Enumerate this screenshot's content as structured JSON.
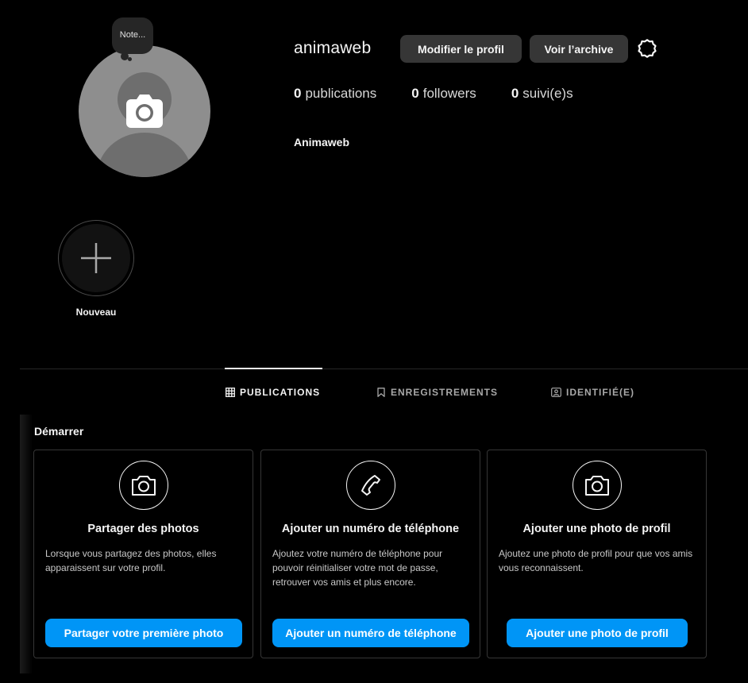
{
  "profile": {
    "note_label": "Note...",
    "username": "animaweb",
    "edit_profile_label": "Modifier le profil",
    "view_archive_label": "Voir l’archive",
    "stats": [
      {
        "count": "0",
        "label": "publications"
      },
      {
        "count": "0",
        "label": "followers"
      },
      {
        "count": "0",
        "label": "suivi(e)s"
      }
    ],
    "full_name": "Animaweb"
  },
  "highlights": {
    "new_label": "Nouveau"
  },
  "tabs": [
    {
      "label": "PUBLICATIONS",
      "icon": "grid-icon",
      "active": true
    },
    {
      "label": "ENREGISTREMENTS",
      "icon": "bookmark-icon",
      "active": false
    },
    {
      "label": "IDENTIFIÉ(E)",
      "icon": "tagged-user-icon",
      "active": false
    }
  ],
  "start": {
    "title": "Démarrer",
    "cards": [
      {
        "icon": "camera-icon",
        "title": "Partager des photos",
        "description": "Lorsque vous partagez des photos, elles apparaissent sur votre profil.",
        "button": "Partager votre première photo"
      },
      {
        "icon": "phone-icon",
        "title": "Ajouter un numéro de téléphone",
        "description": "Ajoutez votre numéro de téléphone pour pouvoir réinitialiser votre mot de passe, retrouver vos amis et plus encore.",
        "button": "Ajouter un numéro de téléphone"
      },
      {
        "icon": "camera-icon",
        "title": "Ajouter une photo de profil",
        "description": "Ajoutez une photo de profil pour que vos amis vous reconnaissent.",
        "button": "Ajouter une photo de profil"
      }
    ]
  },
  "colors": {
    "background": "#000000",
    "primary_button": "#0095f6",
    "secondary_button": "#363636",
    "text": "#f5f5f5"
  }
}
